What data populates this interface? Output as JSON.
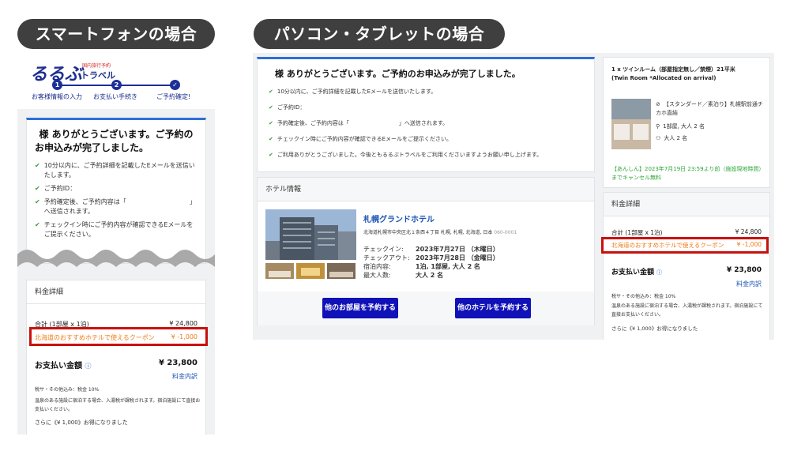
{
  "labels": {
    "sp": "スマートフォンの場合",
    "pc": "パソコン・タブレットの場合"
  },
  "logo": {
    "main": "るるぶ",
    "sub_top": "国内旅行予約",
    "sub_bottom": "トラベル"
  },
  "steps": [
    {
      "num": "1",
      "label": "お客様情報の入力"
    },
    {
      "num": "2",
      "label": "お支払い手続き"
    },
    {
      "num": "✓",
      "label": "ご予約確定!"
    }
  ],
  "thanks": {
    "sp_title_l1": "様 ありがとうございます。ご予約の",
    "sp_title_l2": "お申込みが完了しました。",
    "pc_title": "様 ありがとうございます。ご予約のお申込みが完了しました。",
    "sp_items": [
      "10分以内に、ご予約詳細を記載したEメールを送信いたします。",
      "ご予約ID：",
      "予約確定後、ご予約内容は「　　　　　　　　　　」へ送信されます。",
      "チェックイン時にご予約内容が確認できるEメールをご提示ください。"
    ],
    "pc_items": [
      "10分以内に、ご予約詳細を記載したEメールを送信いたします。",
      "ご予約ID：",
      "予約確定後、ご予約内容は「　　　　　　　　　」へ送信されます。",
      "チェックイン時にご予約内容が確認できるEメールをご提示ください。",
      "ご利用ありがとうございました。今後ともるるぶトラベルをご利用くださいますようお願い申し上げます。"
    ]
  },
  "hotel": {
    "section": "ホテル情報",
    "name": "札幌グランドホテル",
    "address": "北海道札幌市中央区北１条西４丁目 札幌, 札幌, 北海道, 日本",
    "zip": "060-0001",
    "rows": [
      {
        "k": "チェックイン:",
        "v": "2023年7月27日 （木曜日）"
      },
      {
        "k": "チェックアウト:",
        "v": "2023年7月28日 （金曜日）"
      },
      {
        "k": "宿泊内容:",
        "v": "1泊, 1部屋, 大人 2 名"
      },
      {
        "k": "最大人数:",
        "v": "大人 2 名"
      }
    ],
    "btn_room": "他のお部屋を予約する",
    "btn_hotel": "他のホテルを予約する"
  },
  "room": {
    "name_l1": "1 x ツインルーム（部屋指定無し／禁煙）21平米",
    "name_l2": "(Twin Room *Allocated on arrival)",
    "plan": "【スタンダード／素泊り】札幌駅前通チカホ直結",
    "rooms": "1部屋, 大人 2 名",
    "adults": "大人 2 名",
    "cancel": "【あんしん】2023年7月19日 23:59より前（施設現地時間）までキャンセル無料"
  },
  "fees": {
    "section": "料金詳細",
    "total_label": "合計 (1部屋 x 1泊)",
    "total": "¥ 24,800",
    "coupon_label": "北海道のおすすめホテルで使えるクーポン",
    "coupon": "¥ -1,000",
    "pay_label": "お支払い金額",
    "pay": "¥ 23,800",
    "breakdown": "料金内訳",
    "tax_label": "税サ・その他込み：",
    "tax": "税金 10%",
    "onsen": "温泉のある施設に宿泊する場合、入湯税が課税されます。宿泊施設にて直接お支払いください。",
    "saving": "さらに《¥ 1,000》お得になりました"
  },
  "colors": {
    "accent": "#2f6ed8",
    "button": "#1111b8",
    "red": "#c6120e",
    "coupon": "#f07a14",
    "check": "#3a9c3a"
  },
  "icons": [
    "check-icon",
    "info-icon",
    "plan-icon",
    "room-icon",
    "person-icon"
  ]
}
